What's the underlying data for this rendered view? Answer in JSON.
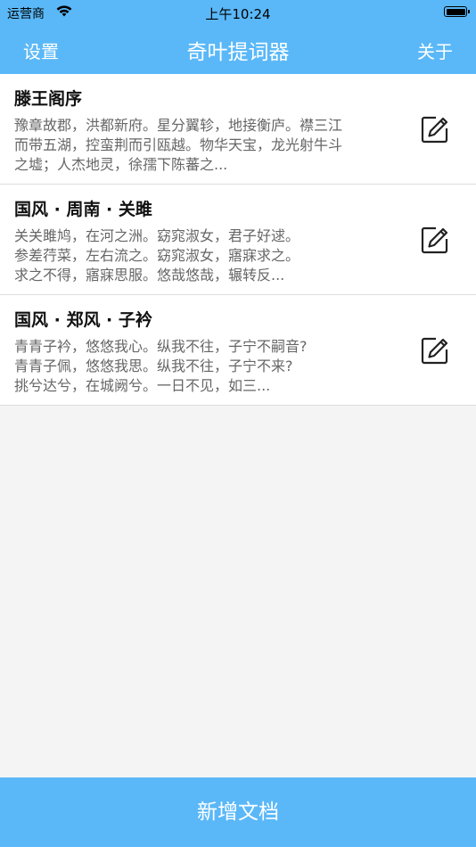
{
  "status_bar": {
    "carrier": "运营商",
    "time": "上午10:24"
  },
  "nav": {
    "left_label": "设置",
    "title": "奇叶提词器",
    "right_label": "关于"
  },
  "documents": [
    {
      "title": "滕王阁序",
      "preview": "豫章故郡，洪都新府。星分翼轸，地接衡庐。襟三江\n而带五湖，控蛮荆而引瓯越。物华天宝，龙光射牛斗\n之墟；人杰地灵，徐孺下陈蕃之..."
    },
    {
      "title": "国风 · 周南 · 关雎",
      "preview": "关关雎鸠，在河之洲。窈窕淑女，君子好逑。\n参差荇菜，左右流之。窈窕淑女，寤寐求之。\n求之不得，寤寐思服。悠哉悠哉，辗转反..."
    },
    {
      "title": "国风 · 郑风 · 子衿",
      "preview": "青青子衿，悠悠我心。纵我不往，子宁不嗣音?\n青青子佩，悠悠我思。纵我不往，子宁不来?\n挑兮达兮，在城阙兮。一日不见，如三..."
    }
  ],
  "icons": {
    "edit": "edit-icon",
    "wifi": "wifi-icon",
    "battery": "battery-icon"
  },
  "footer": {
    "add_label": "新增文档"
  },
  "colors": {
    "accent": "#5ab8f8",
    "background": "#f4f4f4"
  }
}
